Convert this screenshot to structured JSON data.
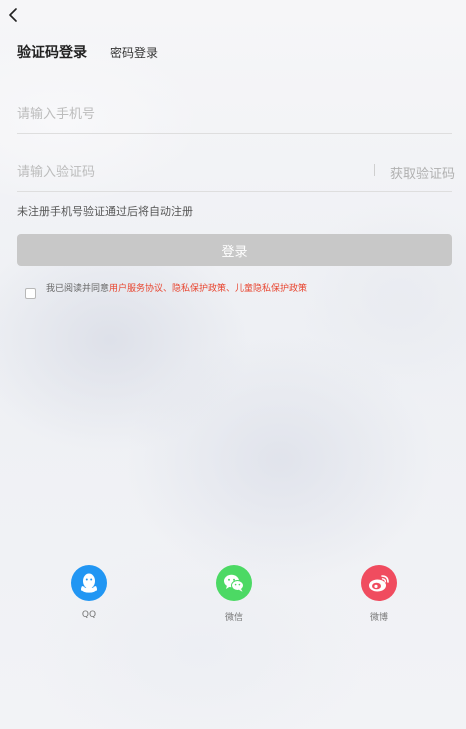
{
  "nav": {
    "back_icon": "chevron-left-icon"
  },
  "tabs": [
    {
      "label": "验证码登录",
      "active": true
    },
    {
      "label": "密码登录",
      "active": false
    }
  ],
  "form": {
    "phone_placeholder": "请输入手机号",
    "code_placeholder": "请输入验证码",
    "get_code_label": "获取验证码",
    "hint": "未注册手机号验证通过后将自动注册",
    "login_label": "登录"
  },
  "agreement": {
    "prefix": "我已阅读并同意",
    "links": "用户服务协议、隐私保护政策、儿童隐私保护政策",
    "checked": false
  },
  "social": [
    {
      "label": "QQ",
      "icon": "qq-icon",
      "color": "#2196f3"
    },
    {
      "label": "微信",
      "icon": "wechat-icon",
      "color": "#4cd964"
    },
    {
      "label": "微博",
      "icon": "weibo-icon",
      "color": "#f04c5f"
    }
  ],
  "colors": {
    "link": "#e8452f",
    "button_disabled": "#c8c8c8"
  }
}
